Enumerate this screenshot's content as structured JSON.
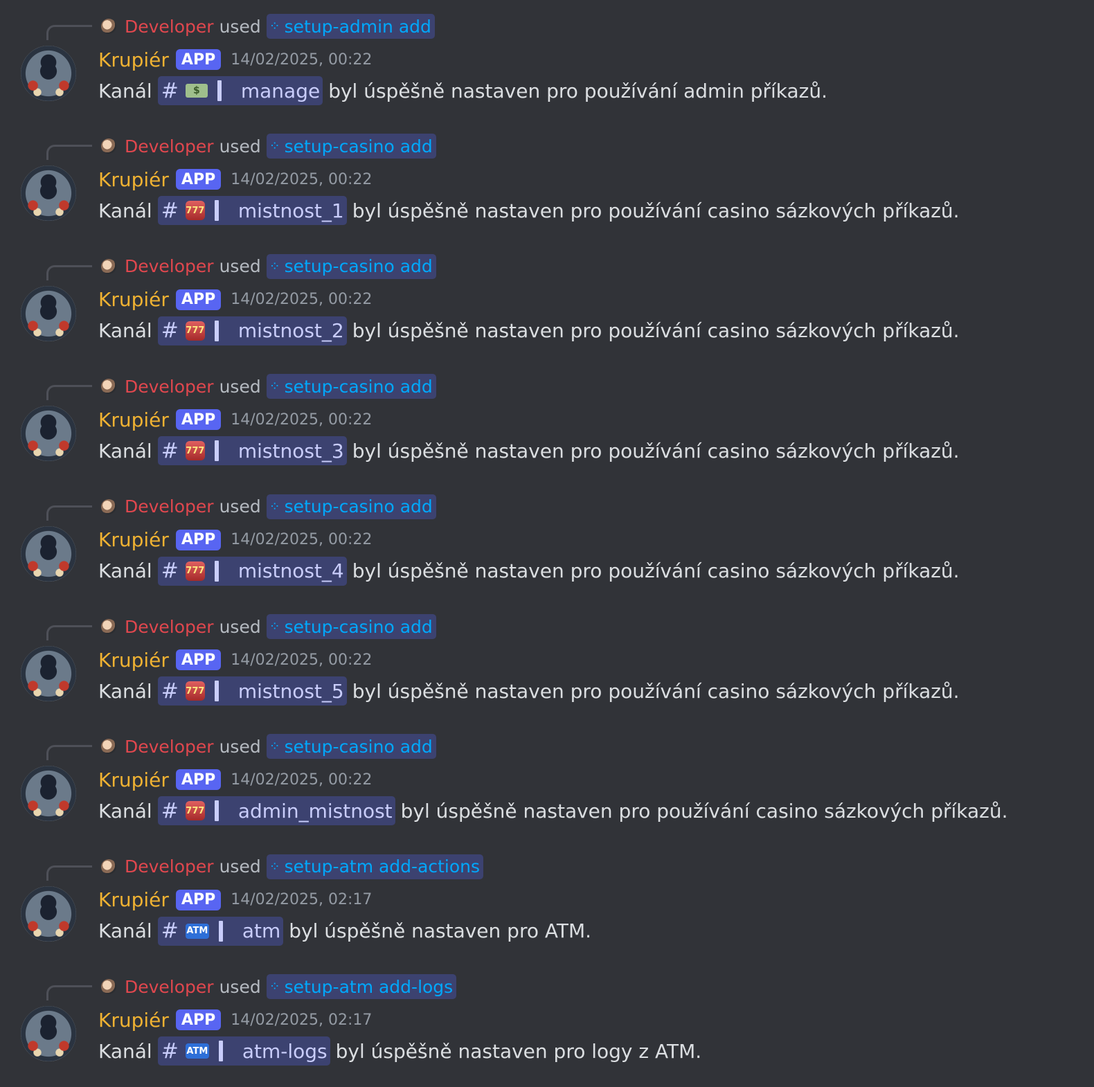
{
  "messages": [
    {
      "reply": {
        "user": "Developer",
        "verb": "used",
        "command": "setup-admin add"
      },
      "author": "Krupiér",
      "badge": "APP",
      "timestamp": "14/02/2025, 00:22",
      "prefix": "Kanál",
      "channel": {
        "hash": "#",
        "emoji": "money-with-wings-icon",
        "emoji_text": "$",
        "name": "manage"
      },
      "suffix": "byl úspěšně nastaven pro používání admin příkazů."
    },
    {
      "reply": {
        "user": "Developer",
        "verb": "used",
        "command": "setup-casino add"
      },
      "author": "Krupiér",
      "badge": "APP",
      "timestamp": "14/02/2025, 00:22",
      "prefix": "Kanál",
      "channel": {
        "hash": "#",
        "emoji": "slot-machine-icon",
        "emoji_text": "777",
        "name": "mistnost_1"
      },
      "suffix": "byl úspěšně nastaven pro používání casino sázkových příkazů."
    },
    {
      "reply": {
        "user": "Developer",
        "verb": "used",
        "command": "setup-casino add"
      },
      "author": "Krupiér",
      "badge": "APP",
      "timestamp": "14/02/2025, 00:22",
      "prefix": "Kanál",
      "channel": {
        "hash": "#",
        "emoji": "slot-machine-icon",
        "emoji_text": "777",
        "name": "mistnost_2"
      },
      "suffix": "byl úspěšně nastaven pro používání casino sázkových příkazů."
    },
    {
      "reply": {
        "user": "Developer",
        "verb": "used",
        "command": "setup-casino add"
      },
      "author": "Krupiér",
      "badge": "APP",
      "timestamp": "14/02/2025, 00:22",
      "prefix": "Kanál",
      "channel": {
        "hash": "#",
        "emoji": "slot-machine-icon",
        "emoji_text": "777",
        "name": "mistnost_3"
      },
      "suffix": "byl úspěšně nastaven pro používání casino sázkových příkazů."
    },
    {
      "reply": {
        "user": "Developer",
        "verb": "used",
        "command": "setup-casino add"
      },
      "author": "Krupiér",
      "badge": "APP",
      "timestamp": "14/02/2025, 00:22",
      "prefix": "Kanál",
      "channel": {
        "hash": "#",
        "emoji": "slot-machine-icon",
        "emoji_text": "777",
        "name": "mistnost_4"
      },
      "suffix": "byl úspěšně nastaven pro používání casino sázkových příkazů."
    },
    {
      "reply": {
        "user": "Developer",
        "verb": "used",
        "command": "setup-casino add"
      },
      "author": "Krupiér",
      "badge": "APP",
      "timestamp": "14/02/2025, 00:22",
      "prefix": "Kanál",
      "channel": {
        "hash": "#",
        "emoji": "slot-machine-icon",
        "emoji_text": "777",
        "name": "mistnost_5"
      },
      "suffix": "byl úspěšně nastaven pro používání casino sázkových příkazů."
    },
    {
      "reply": {
        "user": "Developer",
        "verb": "used",
        "command": "setup-casino add"
      },
      "author": "Krupiér",
      "badge": "APP",
      "timestamp": "14/02/2025, 00:22",
      "prefix": "Kanál",
      "channel": {
        "hash": "#",
        "emoji": "slot-machine-icon",
        "emoji_text": "777",
        "name": "admin_mistnost"
      },
      "suffix": "byl úspěšně nastaven pro používání casino sázkových příkazů."
    },
    {
      "reply": {
        "user": "Developer",
        "verb": "used",
        "command": "setup-atm add-actions"
      },
      "author": "Krupiér",
      "badge": "APP",
      "timestamp": "14/02/2025, 02:17",
      "prefix": "Kanál",
      "channel": {
        "hash": "#",
        "emoji": "atm-icon",
        "emoji_text": "ATM",
        "name": "atm"
      },
      "suffix": "byl úspěšně nastaven pro ATM."
    },
    {
      "reply": {
        "user": "Developer",
        "verb": "used",
        "command": "setup-atm add-logs"
      },
      "author": "Krupiér",
      "badge": "APP",
      "timestamp": "14/02/2025, 02:17",
      "prefix": "Kanál",
      "channel": {
        "hash": "#",
        "emoji": "atm-icon",
        "emoji_text": "ATM",
        "name": "atm-logs"
      },
      "suffix": "byl úspěšně nastaven pro logy z ATM."
    }
  ],
  "colors": {
    "background": "#313338",
    "developer_name": "#e0474e",
    "bot_name": "#f0b232",
    "app_badge": "#5865f2",
    "command_link": "#00a8fc",
    "mention_bg": "#3c4270",
    "mention_text": "#c9cdfb"
  }
}
